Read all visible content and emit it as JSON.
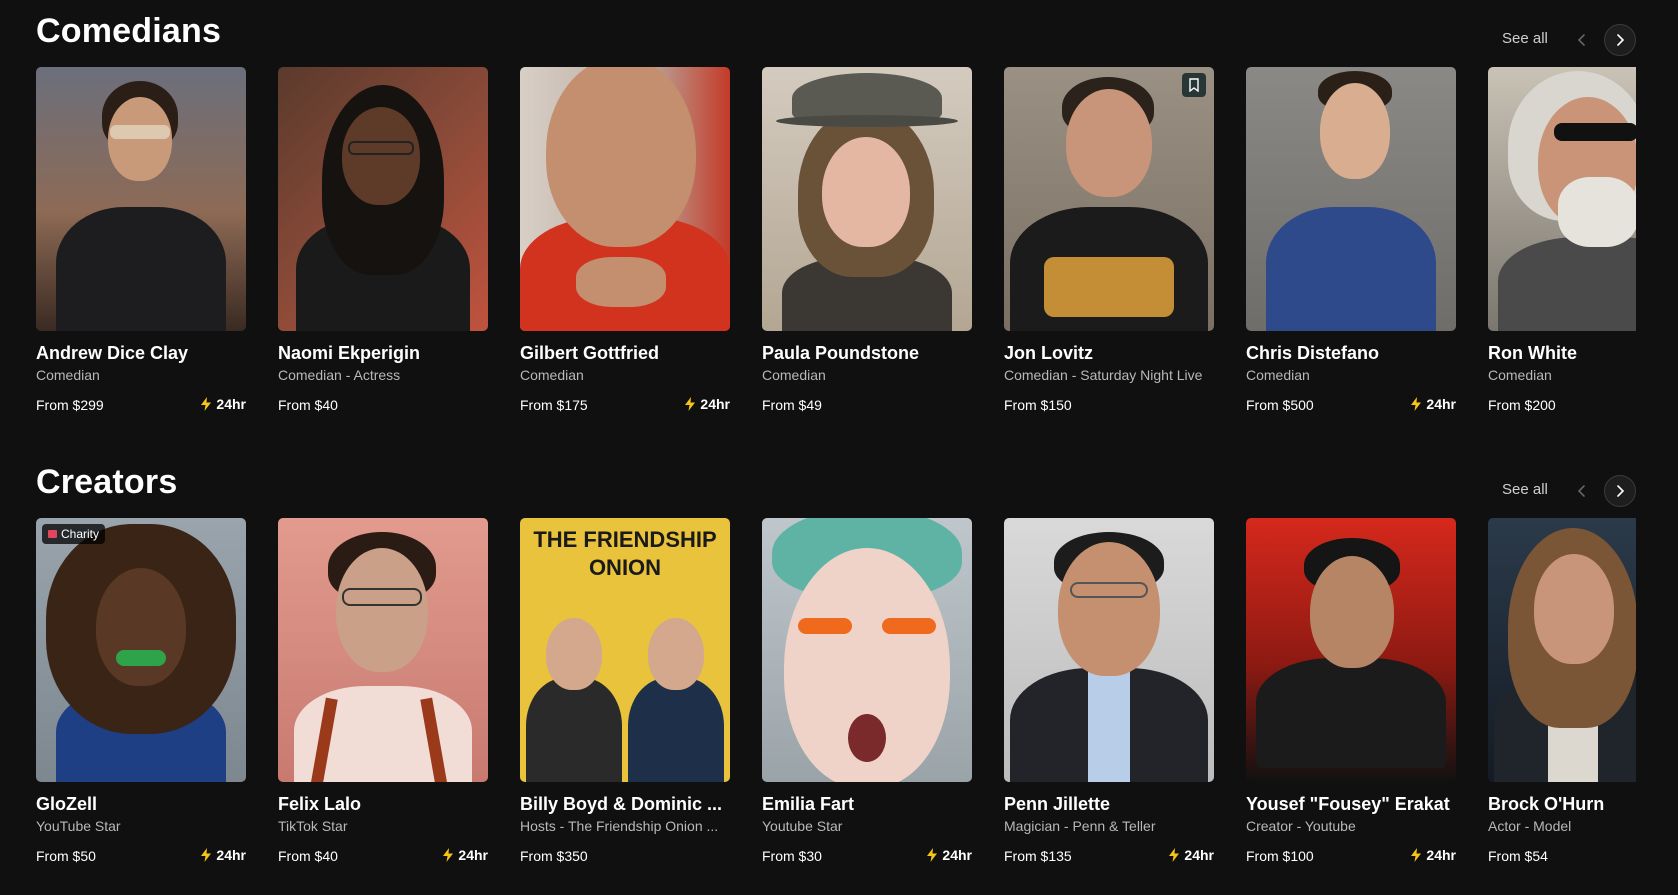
{
  "colors": {
    "background": "#101010",
    "fast_icon": "#f5c518"
  },
  "sections": [
    {
      "title": "Comedians",
      "see_all": "See all",
      "cards": [
        {
          "name": "Andrew Dice Clay",
          "category": "Comedian",
          "price": "From $299",
          "fast": "24hr"
        },
        {
          "name": "Naomi Ekperigin",
          "category": "Comedian - Actress",
          "price": "From $40",
          "fast": ""
        },
        {
          "name": "Gilbert Gottfried",
          "category": "Comedian",
          "price": "From $175",
          "fast": "24hr"
        },
        {
          "name": "Paula Poundstone",
          "category": "Comedian",
          "price": "From $49",
          "fast": ""
        },
        {
          "name": "Jon Lovitz",
          "category": "Comedian - Saturday Night Live",
          "price": "From $150",
          "fast": ""
        },
        {
          "name": "Chris Distefano",
          "category": "Comedian",
          "price": "From $500",
          "fast": "24hr"
        },
        {
          "name": "Ron White",
          "category": "Comedian",
          "price": "From $200",
          "fast": ""
        }
      ]
    },
    {
      "title": "Creators",
      "see_all": "See all",
      "cards": [
        {
          "name": "GloZell",
          "category": "YouTube Star",
          "price": "From $50",
          "fast": "24hr",
          "badge": "Charity"
        },
        {
          "name": "Felix Lalo",
          "category": "TikTok Star",
          "price": "From $40",
          "fast": "24hr"
        },
        {
          "name": "Billy Boyd & Dominic ...",
          "category": "Hosts - The Friendship Onion ...",
          "price": "From $350",
          "fast": "",
          "poster_text": "THE FRIENDSHIP ONION"
        },
        {
          "name": "Emilia Fart",
          "category": "Youtube Star",
          "price": "From $30",
          "fast": "24hr"
        },
        {
          "name": "Penn Jillette",
          "category": "Magician - Penn & Teller",
          "price": "From $135",
          "fast": "24hr"
        },
        {
          "name": "Yousef \"Fousey\" Erakat",
          "category": "Creator - Youtube",
          "price": "From $100",
          "fast": "24hr"
        },
        {
          "name": "Brock O'Hurn",
          "category": "Actor - Model",
          "price": "From $54",
          "fast": ""
        }
      ]
    }
  ]
}
